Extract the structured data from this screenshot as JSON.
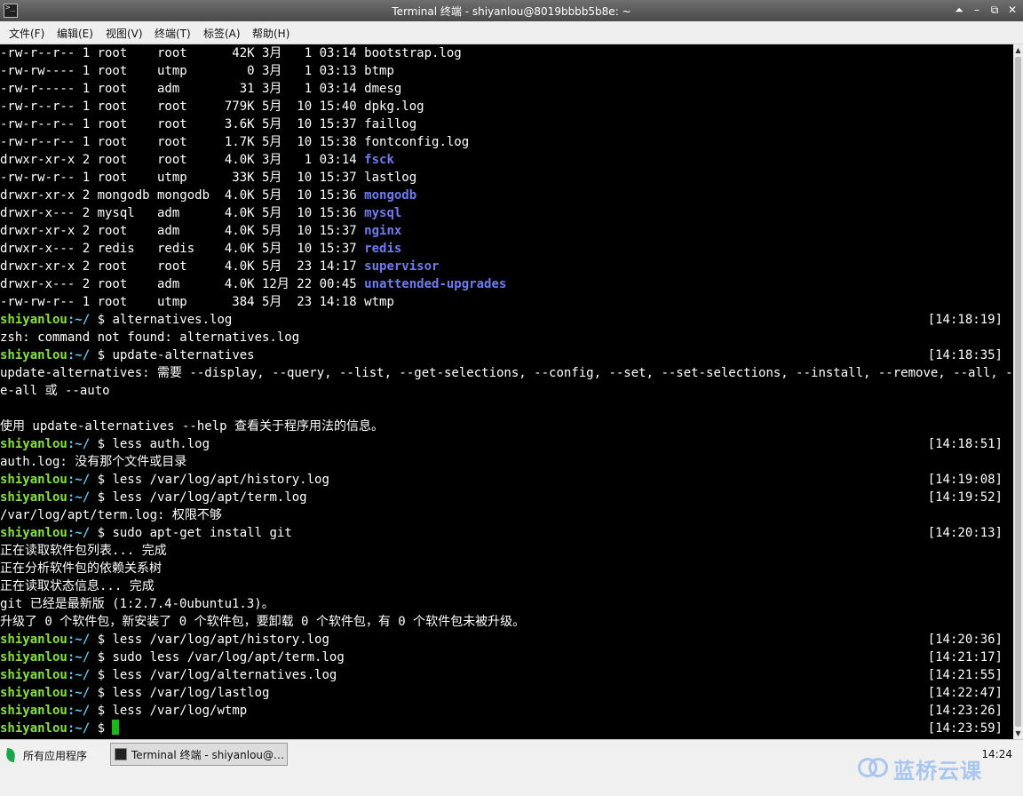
{
  "window": {
    "title": "Terminal 终端 - shiyanlou@8019bbbb5b8e: ~",
    "buttons": [
      "⏶",
      "–",
      "⧉",
      "✕"
    ]
  },
  "menu": [
    "文件(F)",
    "编辑(E)",
    "视图(V)",
    "终端(T)",
    "标签(A)",
    "帮助(H)"
  ],
  "terminal": {
    "prompt_user": "shiyanlou",
    "prompt_path": ":~/",
    "prompt_symbol": " $ ",
    "lines": [
      {
        "type": "ls",
        "perms": "-rw-r--r--",
        "links": "1",
        "owner": "root   ",
        "group": "root   ",
        "size": "  42K",
        "month": "3月",
        "day": "  1",
        "time": "03:14",
        "name": "bootstrap.log",
        "dir": false
      },
      {
        "type": "ls",
        "perms": "-rw-rw----",
        "links": "1",
        "owner": "root   ",
        "group": "utmp   ",
        "size": "    0",
        "month": "3月",
        "day": "  1",
        "time": "03:13",
        "name": "btmp",
        "dir": false
      },
      {
        "type": "ls",
        "perms": "-rw-r-----",
        "links": "1",
        "owner": "root   ",
        "group": "adm    ",
        "size": "   31",
        "month": "3月",
        "day": "  1",
        "time": "03:14",
        "name": "dmesg",
        "dir": false
      },
      {
        "type": "ls",
        "perms": "-rw-r--r--",
        "links": "1",
        "owner": "root   ",
        "group": "root   ",
        "size": " 779K",
        "month": "5月",
        "day": " 10",
        "time": "15:40",
        "name": "dpkg.log",
        "dir": false
      },
      {
        "type": "ls",
        "perms": "-rw-r--r--",
        "links": "1",
        "owner": "root   ",
        "group": "root   ",
        "size": " 3.6K",
        "month": "5月",
        "day": " 10",
        "time": "15:37",
        "name": "faillog",
        "dir": false
      },
      {
        "type": "ls",
        "perms": "-rw-r--r--",
        "links": "1",
        "owner": "root   ",
        "group": "root   ",
        "size": " 1.7K",
        "month": "5月",
        "day": " 10",
        "time": "15:38",
        "name": "fontconfig.log",
        "dir": false
      },
      {
        "type": "ls",
        "perms": "drwxr-xr-x",
        "links": "2",
        "owner": "root   ",
        "group": "root   ",
        "size": " 4.0K",
        "month": "3月",
        "day": "  1",
        "time": "03:14",
        "name": "fsck",
        "dir": true
      },
      {
        "type": "ls",
        "perms": "-rw-rw-r--",
        "links": "1",
        "owner": "root   ",
        "group": "utmp   ",
        "size": "  33K",
        "month": "5月",
        "day": " 10",
        "time": "15:37",
        "name": "lastlog",
        "dir": false
      },
      {
        "type": "ls",
        "perms": "drwxr-xr-x",
        "links": "2",
        "owner": "mongodb",
        "group": "mongodb",
        "size": " 4.0K",
        "month": "5月",
        "day": " 10",
        "time": "15:36",
        "name": "mongodb",
        "dir": true
      },
      {
        "type": "ls",
        "perms": "drwxr-x---",
        "links": "2",
        "owner": "mysql  ",
        "group": "adm    ",
        "size": " 4.0K",
        "month": "5月",
        "day": " 10",
        "time": "15:36",
        "name": "mysql",
        "dir": true
      },
      {
        "type": "ls",
        "perms": "drwxr-xr-x",
        "links": "2",
        "owner": "root   ",
        "group": "adm    ",
        "size": " 4.0K",
        "month": "5月",
        "day": " 10",
        "time": "15:37",
        "name": "nginx",
        "dir": true
      },
      {
        "type": "ls",
        "perms": "drwxr-x---",
        "links": "2",
        "owner": "redis  ",
        "group": "redis  ",
        "size": " 4.0K",
        "month": "5月",
        "day": " 10",
        "time": "15:37",
        "name": "redis",
        "dir": true
      },
      {
        "type": "ls",
        "perms": "drwxr-xr-x",
        "links": "2",
        "owner": "root   ",
        "group": "root   ",
        "size": " 4.0K",
        "month": "5月",
        "day": " 23",
        "time": "14:17",
        "name": "supervisor",
        "dir": true
      },
      {
        "type": "ls",
        "perms": "drwxr-x---",
        "links": "2",
        "owner": "root   ",
        "group": "adm    ",
        "size": " 4.0K",
        "month": "12月",
        "day": "22",
        "time": "00:45",
        "name": "unattended-upgrades",
        "dir": true
      },
      {
        "type": "ls",
        "perms": "-rw-rw-r--",
        "links": "1",
        "owner": "root   ",
        "group": "utmp   ",
        "size": "  384",
        "month": "5月",
        "day": " 23",
        "time": "14:18",
        "name": "wtmp",
        "dir": false
      },
      {
        "type": "prompt",
        "cmd": "alternatives.log",
        "ts": "[14:18:19]"
      },
      {
        "type": "out",
        "text": "zsh: command not found: alternatives.log"
      },
      {
        "type": "prompt",
        "cmd": "update-alternatives",
        "ts": "[14:18:35]"
      },
      {
        "type": "out",
        "text": "update-alternatives: 需要 --display, --query, --list, --get-selections, --config, --set, --set-selections, --install, --remove, --all, --remov"
      },
      {
        "type": "out",
        "text": "e-all 或 --auto"
      },
      {
        "type": "out",
        "text": ""
      },
      {
        "type": "out",
        "text": "使用 update-alternatives --help 查看关于程序用法的信息。"
      },
      {
        "type": "prompt",
        "cmd": "less auth.log",
        "ts": "[14:18:51]"
      },
      {
        "type": "out",
        "text": "auth.log: 没有那个文件或目录"
      },
      {
        "type": "prompt",
        "cmd": "less /var/log/apt/history.log",
        "ts": "[14:19:08]"
      },
      {
        "type": "prompt",
        "cmd": "less /var/log/apt/term.log",
        "ts": "[14:19:52]"
      },
      {
        "type": "out",
        "text": "/var/log/apt/term.log: 权限不够"
      },
      {
        "type": "prompt",
        "cmd": "sudo apt-get install git",
        "ts": "[14:20:13]"
      },
      {
        "type": "out",
        "text": "正在读取软件包列表... 完成"
      },
      {
        "type": "out",
        "text": "正在分析软件包的依赖关系树"
      },
      {
        "type": "out",
        "text": "正在读取状态信息... 完成"
      },
      {
        "type": "out",
        "text": "git 已经是最新版 (1:2.7.4-0ubuntu1.3)。"
      },
      {
        "type": "out",
        "text": "升级了 0 个软件包，新安装了 0 个软件包，要卸载 0 个软件包，有 0 个软件包未被升级。"
      },
      {
        "type": "prompt",
        "cmd": "less /var/log/apt/history.log",
        "ts": "[14:20:36]"
      },
      {
        "type": "prompt",
        "cmd": "sudo less /var/log/apt/term.log",
        "ts": "[14:21:17]"
      },
      {
        "type": "prompt",
        "cmd": "less /var/log/alternatives.log",
        "ts": "[14:21:55]"
      },
      {
        "type": "prompt",
        "cmd": "less /var/log/lastlog",
        "ts": "[14:22:47]"
      },
      {
        "type": "prompt",
        "cmd": "less /var/log/wtmp",
        "ts": "[14:23:26]"
      },
      {
        "type": "prompt",
        "cmd": "",
        "ts": "[14:23:59]",
        "cursor": true
      }
    ]
  },
  "taskbar": {
    "start_label": "所有应用程序",
    "task_label": "Terminal 终端 - shiyanlou@…",
    "clock": "14:24",
    "brand": "蓝桥云课"
  },
  "colors": {
    "terminal_bg": "#000000",
    "dir": "#6d7cf0",
    "prompt_user": "#86e13a",
    "prompt_path": "#5bc8f0",
    "cursor": "#18b918"
  }
}
